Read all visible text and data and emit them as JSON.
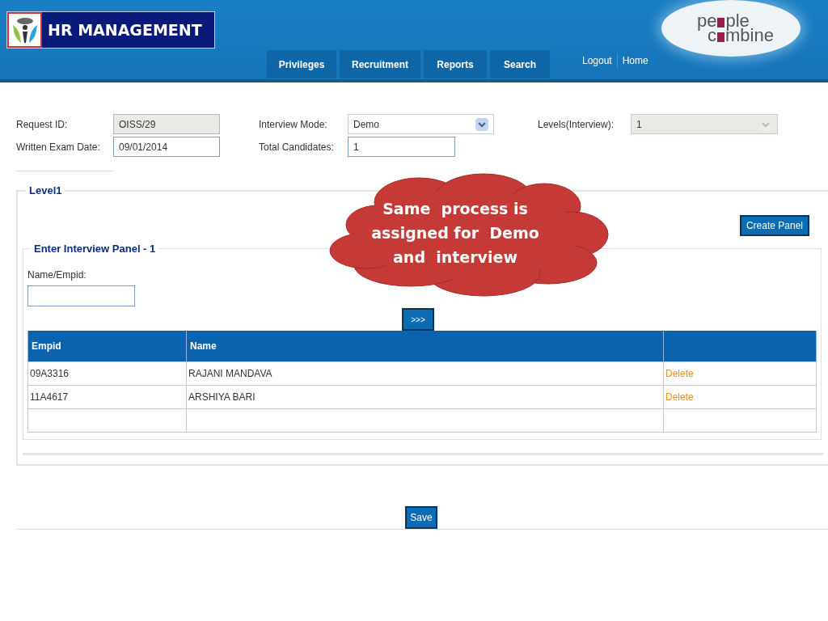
{
  "header": {
    "title": "HR MANAGEMENT",
    "tabs": [
      {
        "label": "Privileges"
      },
      {
        "label": "Recruitment"
      },
      {
        "label": "Reports"
      },
      {
        "label": "Search"
      }
    ],
    "links": [
      "Logout",
      "Home"
    ],
    "brand": {
      "line_1_start": "pe",
      "line_1_end": "ple",
      "line_2_start": "c",
      "line_2_end": "mbine"
    }
  },
  "form": {
    "columns": [
      [
        {
          "label": "Request ID:",
          "kind": "text",
          "value": "OISS/29",
          "disabled": true
        },
        {
          "label": "Written Exam Date:",
          "kind": "text",
          "value": "09/01/2014",
          "disabled": false
        }
      ],
      [
        {
          "label": "Interview Mode:",
          "kind": "select",
          "value": "Demo",
          "disabled": false
        },
        {
          "label": "Total Candidates:",
          "kind": "text",
          "value": "1",
          "disabled": false
        }
      ],
      [
        {
          "label": "Levels(Interview):",
          "kind": "select",
          "value": "1",
          "disabled": true
        }
      ]
    ]
  },
  "level": {
    "title": "Level1",
    "create_button": "Create Panel",
    "panel": {
      "title": "Enter Interview Panel - 1",
      "field_label": "Name/Empid:",
      "add_button": ">>>",
      "table": {
        "columns": [
          "Empid",
          "Name",
          ""
        ],
        "rows": [
          [
            "09A3316",
            "RAJANI MANDAVA",
            "Delete"
          ],
          [
            "11A4617",
            "ARSHIYA BARI",
            "Delete"
          ],
          [
            "",
            "",
            ""
          ]
        ]
      }
    }
  },
  "save_button": "Save",
  "callout": {
    "lines": [
      "Same  process is",
      "assigned for  Demo",
      "and  interview"
    ]
  }
}
